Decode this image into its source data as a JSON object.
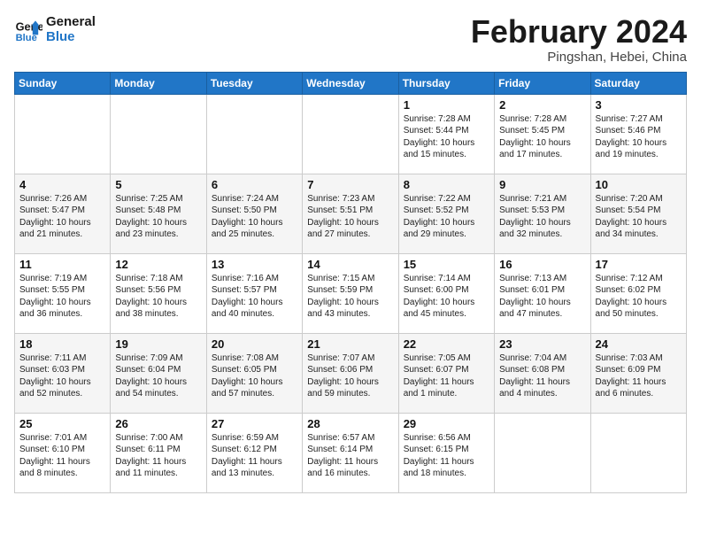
{
  "header": {
    "logo_line1": "General",
    "logo_line2": "Blue",
    "month_year": "February 2024",
    "location": "Pingshan, Hebei, China"
  },
  "weekdays": [
    "Sunday",
    "Monday",
    "Tuesday",
    "Wednesday",
    "Thursday",
    "Friday",
    "Saturday"
  ],
  "weeks": [
    [
      {
        "day": "",
        "info": ""
      },
      {
        "day": "",
        "info": ""
      },
      {
        "day": "",
        "info": ""
      },
      {
        "day": "",
        "info": ""
      },
      {
        "day": "1",
        "info": "Sunrise: 7:28 AM\nSunset: 5:44 PM\nDaylight: 10 hours\nand 15 minutes."
      },
      {
        "day": "2",
        "info": "Sunrise: 7:28 AM\nSunset: 5:45 PM\nDaylight: 10 hours\nand 17 minutes."
      },
      {
        "day": "3",
        "info": "Sunrise: 7:27 AM\nSunset: 5:46 PM\nDaylight: 10 hours\nand 19 minutes."
      }
    ],
    [
      {
        "day": "4",
        "info": "Sunrise: 7:26 AM\nSunset: 5:47 PM\nDaylight: 10 hours\nand 21 minutes."
      },
      {
        "day": "5",
        "info": "Sunrise: 7:25 AM\nSunset: 5:48 PM\nDaylight: 10 hours\nand 23 minutes."
      },
      {
        "day": "6",
        "info": "Sunrise: 7:24 AM\nSunset: 5:50 PM\nDaylight: 10 hours\nand 25 minutes."
      },
      {
        "day": "7",
        "info": "Sunrise: 7:23 AM\nSunset: 5:51 PM\nDaylight: 10 hours\nand 27 minutes."
      },
      {
        "day": "8",
        "info": "Sunrise: 7:22 AM\nSunset: 5:52 PM\nDaylight: 10 hours\nand 29 minutes."
      },
      {
        "day": "9",
        "info": "Sunrise: 7:21 AM\nSunset: 5:53 PM\nDaylight: 10 hours\nand 32 minutes."
      },
      {
        "day": "10",
        "info": "Sunrise: 7:20 AM\nSunset: 5:54 PM\nDaylight: 10 hours\nand 34 minutes."
      }
    ],
    [
      {
        "day": "11",
        "info": "Sunrise: 7:19 AM\nSunset: 5:55 PM\nDaylight: 10 hours\nand 36 minutes."
      },
      {
        "day": "12",
        "info": "Sunrise: 7:18 AM\nSunset: 5:56 PM\nDaylight: 10 hours\nand 38 minutes."
      },
      {
        "day": "13",
        "info": "Sunrise: 7:16 AM\nSunset: 5:57 PM\nDaylight: 10 hours\nand 40 minutes."
      },
      {
        "day": "14",
        "info": "Sunrise: 7:15 AM\nSunset: 5:59 PM\nDaylight: 10 hours\nand 43 minutes."
      },
      {
        "day": "15",
        "info": "Sunrise: 7:14 AM\nSunset: 6:00 PM\nDaylight: 10 hours\nand 45 minutes."
      },
      {
        "day": "16",
        "info": "Sunrise: 7:13 AM\nSunset: 6:01 PM\nDaylight: 10 hours\nand 47 minutes."
      },
      {
        "day": "17",
        "info": "Sunrise: 7:12 AM\nSunset: 6:02 PM\nDaylight: 10 hours\nand 50 minutes."
      }
    ],
    [
      {
        "day": "18",
        "info": "Sunrise: 7:11 AM\nSunset: 6:03 PM\nDaylight: 10 hours\nand 52 minutes."
      },
      {
        "day": "19",
        "info": "Sunrise: 7:09 AM\nSunset: 6:04 PM\nDaylight: 10 hours\nand 54 minutes."
      },
      {
        "day": "20",
        "info": "Sunrise: 7:08 AM\nSunset: 6:05 PM\nDaylight: 10 hours\nand 57 minutes."
      },
      {
        "day": "21",
        "info": "Sunrise: 7:07 AM\nSunset: 6:06 PM\nDaylight: 10 hours\nand 59 minutes."
      },
      {
        "day": "22",
        "info": "Sunrise: 7:05 AM\nSunset: 6:07 PM\nDaylight: 11 hours\nand 1 minute."
      },
      {
        "day": "23",
        "info": "Sunrise: 7:04 AM\nSunset: 6:08 PM\nDaylight: 11 hours\nand 4 minutes."
      },
      {
        "day": "24",
        "info": "Sunrise: 7:03 AM\nSunset: 6:09 PM\nDaylight: 11 hours\nand 6 minutes."
      }
    ],
    [
      {
        "day": "25",
        "info": "Sunrise: 7:01 AM\nSunset: 6:10 PM\nDaylight: 11 hours\nand 8 minutes."
      },
      {
        "day": "26",
        "info": "Sunrise: 7:00 AM\nSunset: 6:11 PM\nDaylight: 11 hours\nand 11 minutes."
      },
      {
        "day": "27",
        "info": "Sunrise: 6:59 AM\nSunset: 6:12 PM\nDaylight: 11 hours\nand 13 minutes."
      },
      {
        "day": "28",
        "info": "Sunrise: 6:57 AM\nSunset: 6:14 PM\nDaylight: 11 hours\nand 16 minutes."
      },
      {
        "day": "29",
        "info": "Sunrise: 6:56 AM\nSunset: 6:15 PM\nDaylight: 11 hours\nand 18 minutes."
      },
      {
        "day": "",
        "info": ""
      },
      {
        "day": "",
        "info": ""
      }
    ]
  ]
}
